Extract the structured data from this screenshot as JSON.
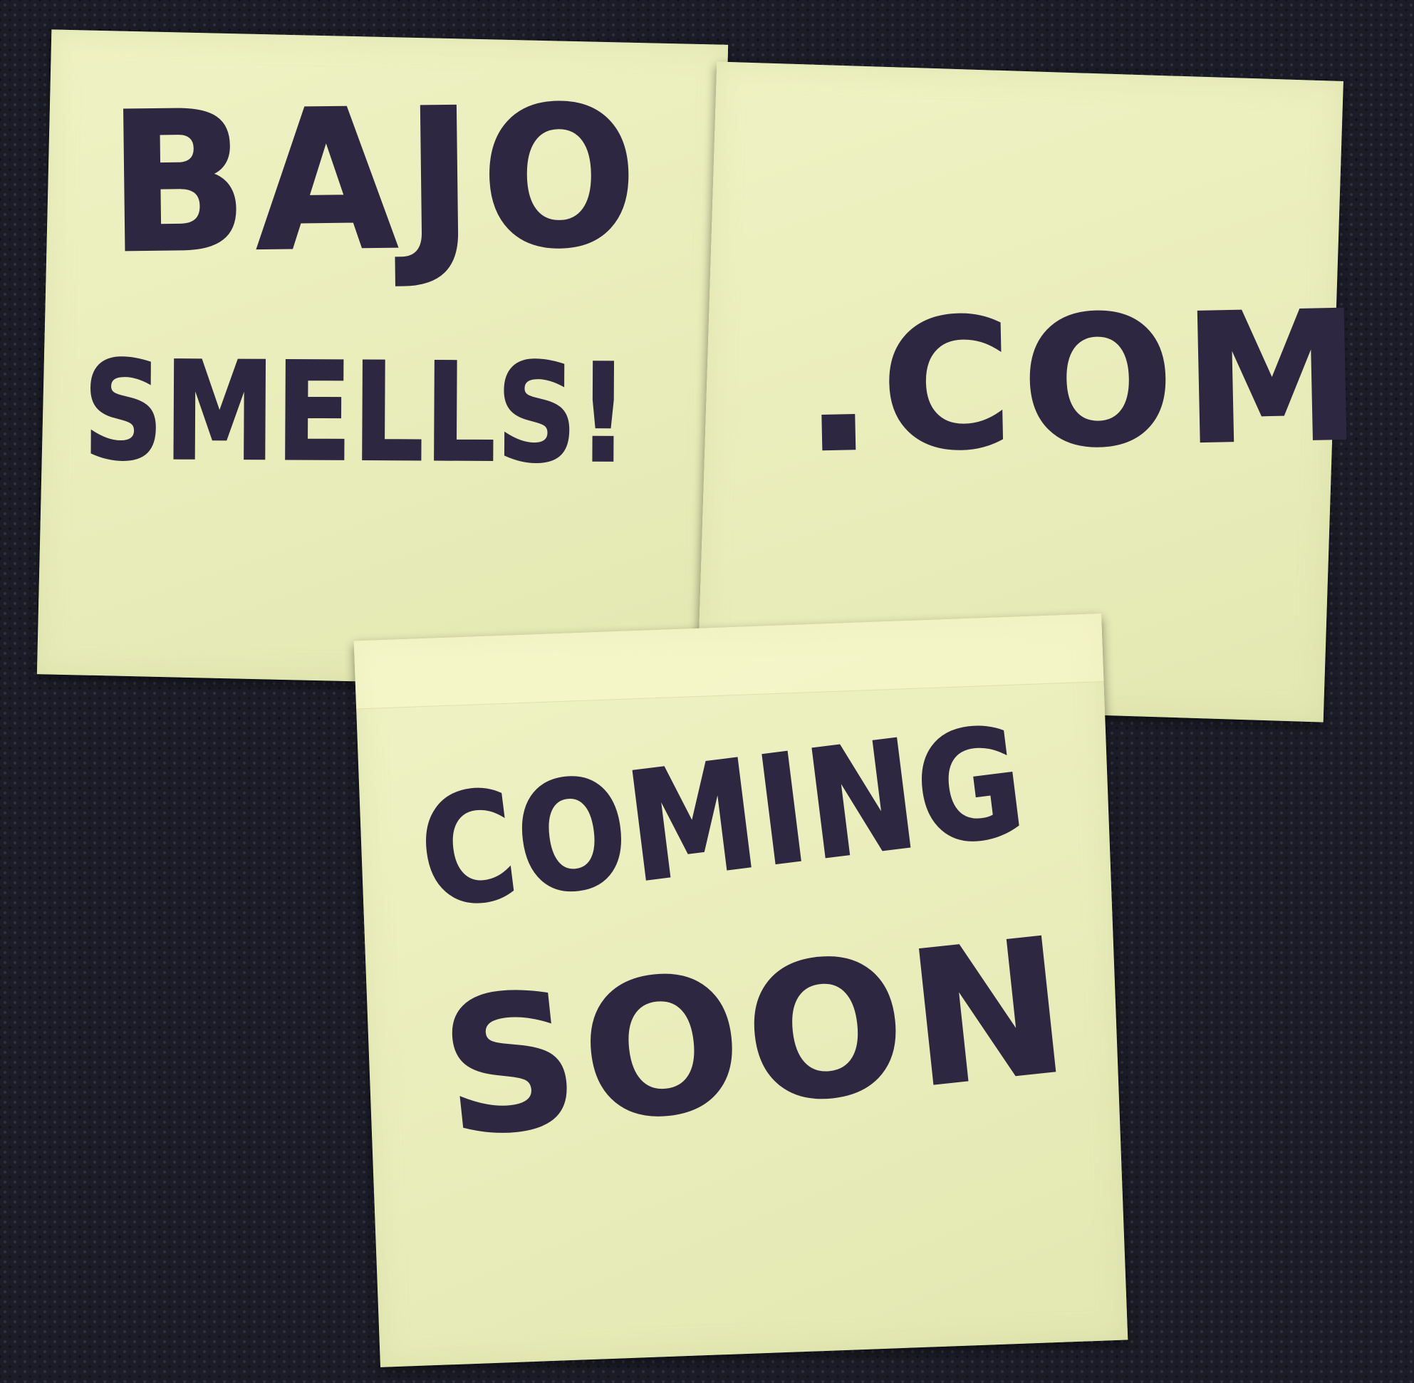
{
  "notes": [
    {
      "lines": [
        "BAJO",
        "SMELLS!"
      ]
    },
    {
      "lines": [
        ".COM"
      ]
    },
    {
      "lines": [
        "COMING",
        "SOON"
      ]
    }
  ],
  "colors": {
    "background": "#1b1c27",
    "paper": "#ecefbf",
    "ink": "#2e2741"
  }
}
